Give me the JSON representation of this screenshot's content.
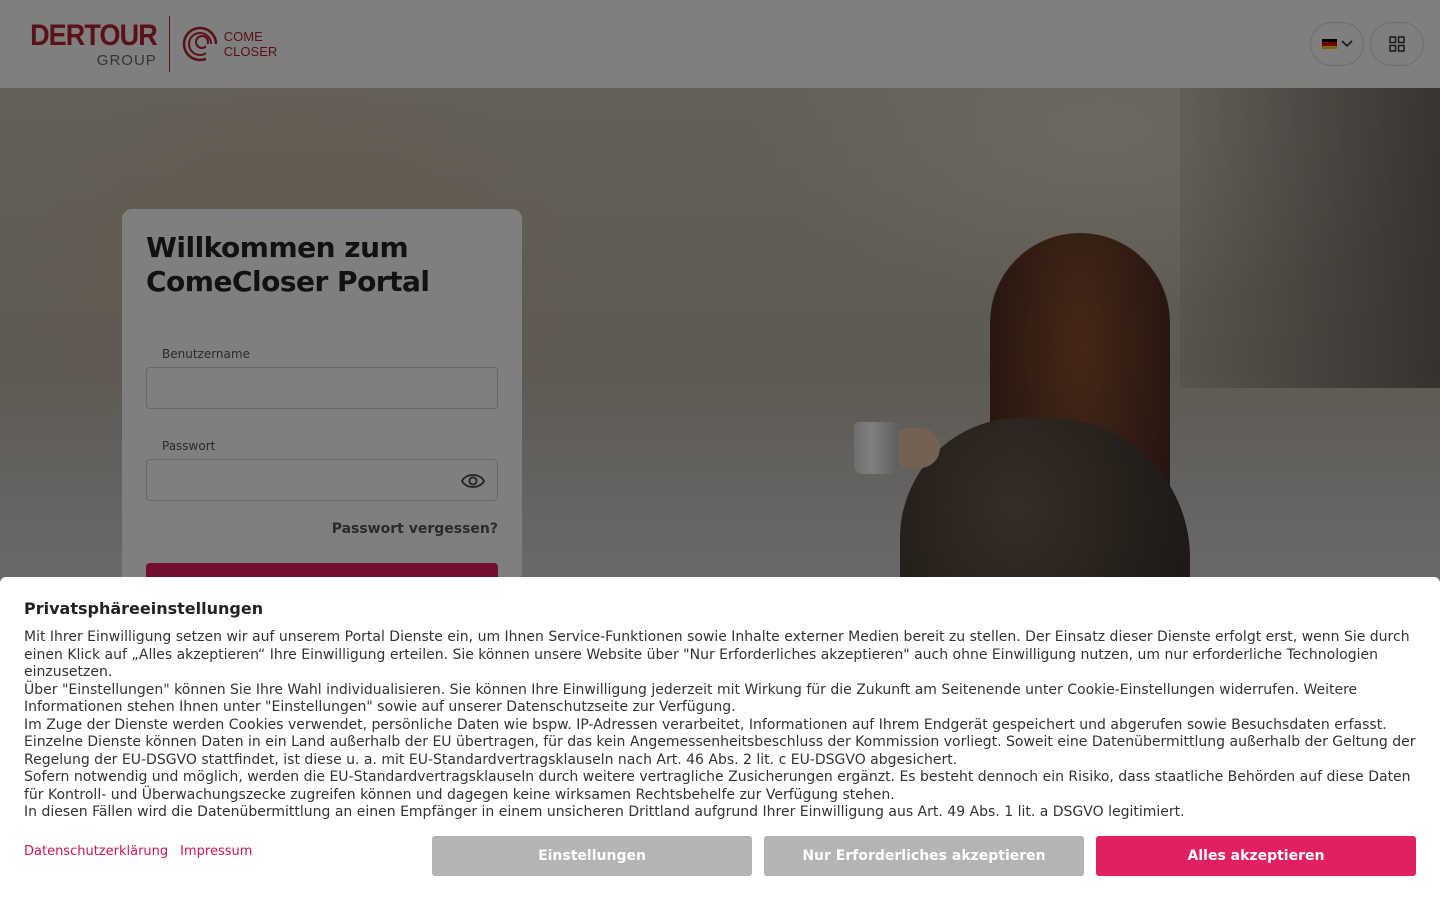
{
  "header": {
    "logo_brand": "DERTOUR",
    "logo_group": "GROUP",
    "logo_cc_line1": "COME",
    "logo_cc_line2": "CLOSER",
    "language_flag": "de-flag-icon",
    "apps_icon": "grid-icon"
  },
  "login": {
    "title_line1": "Willkommen zum",
    "title_line2": "ComeCloser Portal",
    "username_label": "Benutzername",
    "username_value": "",
    "password_label": "Passwort",
    "password_value": "",
    "forgot_password": "Passwort vergessen?"
  },
  "cookie": {
    "title": "Privatsphäreeinstellungen",
    "paragraphs": [
      "Mit Ihrer Einwilligung setzen wir auf unserem Portal Dienste ein, um Ihnen Service-Funktionen sowie Inhalte externer Medien bereit zu stellen. Der Einsatz dieser Dienste erfolgt erst, wenn Sie durch einen Klick auf „Alles akzeptieren“ Ihre Einwilligung erteilen. Sie können unsere Website über \"Nur Erforderliches akzeptieren\" auch ohne Einwilligung nutzen, um nur erforderliche Technologien einzusetzen.",
      "Über \"Einstellungen\" können Sie Ihre Wahl individualisieren. Sie können Ihre Einwilligung jederzeit mit Wirkung für die Zukunft am Seitenende unter Cookie-Einstellungen widerrufen. Weitere Informationen stehen Ihnen unter \"Einstellungen\" sowie auf unserer Datenschutzseite zur Verfügung.",
      "Im Zuge der Dienste werden Cookies verwendet, persönliche Daten wie bspw. IP-Adressen verarbeitet, Informationen auf Ihrem Endgerät gespeichert und abgerufen sowie Besuchsdaten erfasst.",
      "Einzelne Dienste können Daten in ein Land außerhalb der EU übertragen, für das kein Angemessenheitsbeschluss der Kommission vorliegt. Soweit eine Datenübermittlung außerhalb der Geltung der Regelung der EU-DSGVO stattfindet, ist diese u. a. mit EU-Standardvertragsklauseln nach Art. 46 Abs. 2 lit. c EU-DSGVO abgesichert.",
      "Sofern notwendig und möglich, werden die EU-Standardvertragsklauseln durch weitere vertragliche Zusicherungen ergänzt. Es besteht dennoch ein Risiko, dass staatliche Behörden auf diese Daten für Kontroll- und Überwachungszecke zugreifen können und dagegen keine wirksamen Rechtsbehelfe zur Verfügung stehen.",
      "In diesen Fällen wird die Datenübermittlung an einen Empfänger in einem unsicheren Drittland aufgrund Ihrer Einwilligung aus Art. 49 Abs. 1 lit. a DSGVO legitimiert."
    ],
    "link_privacy": "Datenschutzerklärung",
    "link_imprint": "Impressum",
    "btn_settings": "Einstellungen",
    "btn_necessary": "Nur Erforderliches akzeptieren",
    "btn_accept_all": "Alles akzeptieren"
  },
  "colors": {
    "brand_red": "#b4232e",
    "accent_pink": "#e31f63",
    "button_grey": "#b4b4b4"
  }
}
